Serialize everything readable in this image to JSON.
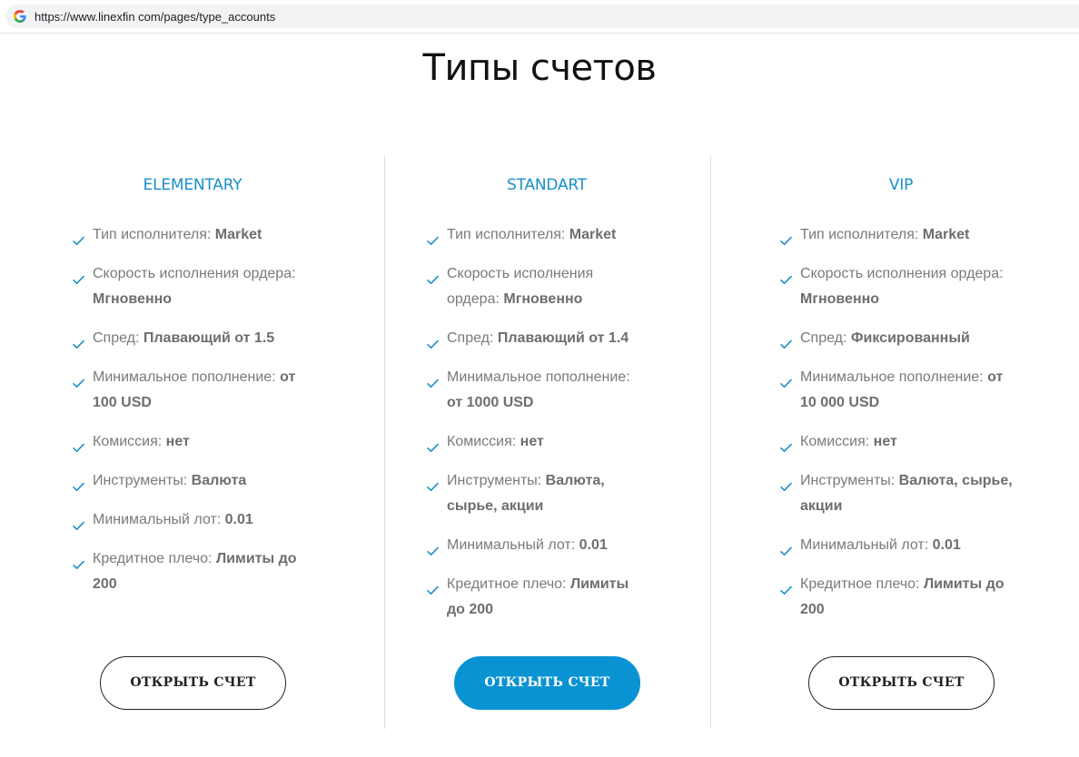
{
  "browser": {
    "url": "https://www.linexfin com/pages/type_accounts"
  },
  "page": {
    "title": "Типы счетов"
  },
  "colors": {
    "accent": "#0a93d3",
    "plan_title": "#1a8fc9",
    "check": "#1a8fc9",
    "text": "#7a7a7a"
  },
  "plans": [
    {
      "name": "ELEMENTARY",
      "button": "ОТКРЫТЬ СЧЕТ",
      "features": [
        {
          "label": "Тип исполнителя: ",
          "value": "Market"
        },
        {
          "label": "Скорость исполнения ордера: ",
          "value": "Мгновенно"
        },
        {
          "label": "Спред: ",
          "value": "Плавающий от 1.5"
        },
        {
          "label": "Минимальное пополнение: ",
          "value": "от 100 USD"
        },
        {
          "label": "Комиссия: ",
          "value": "нет"
        },
        {
          "label": "Инструменты: ",
          "value": "Валюта"
        },
        {
          "label": "Минимальный лот: ",
          "value": "0.01"
        },
        {
          "label": "Кредитное плечо: ",
          "value": "Лимиты до 200"
        }
      ]
    },
    {
      "name": "STANDART",
      "button": "ОТКРЫТЬ СЧЕТ",
      "features": [
        {
          "label": "Тип исполнителя: ",
          "value": "Market"
        },
        {
          "label": "Скорость исполнения ордера: ",
          "value": "Мгновенно"
        },
        {
          "label": "Спред: ",
          "value": "Плавающий от 1.4"
        },
        {
          "label": "Минимальное пополнение: ",
          "value": "от 1000 USD"
        },
        {
          "label": "Комиссия: ",
          "value": "нет"
        },
        {
          "label": "Инструменты: ",
          "value": "Валюта, сырье, акции"
        },
        {
          "label": "Минимальный лот: ",
          "value": "0.01"
        },
        {
          "label": "Кредитное плечо: ",
          "value": "Лимиты до 200"
        }
      ]
    },
    {
      "name": "VIP",
      "button": "ОТКРЫТЬ СЧЕТ",
      "features": [
        {
          "label": "Тип исполнителя: ",
          "value": "Market"
        },
        {
          "label": "Скорость исполнения ордера: ",
          "value": "Мгновенно"
        },
        {
          "label": "Спред: ",
          "value": "Фиксированный"
        },
        {
          "label": "Минимальное пополнение: ",
          "value": "от 10 000 USD"
        },
        {
          "label": "Комиссия: ",
          "value": "нет"
        },
        {
          "label": "Инструменты: ",
          "value": "Валюта, сырье, акции"
        },
        {
          "label": "Минимальный лот: ",
          "value": "0.01"
        },
        {
          "label": "Кредитное плечо: ",
          "value": "Лимиты до 200"
        }
      ]
    }
  ]
}
